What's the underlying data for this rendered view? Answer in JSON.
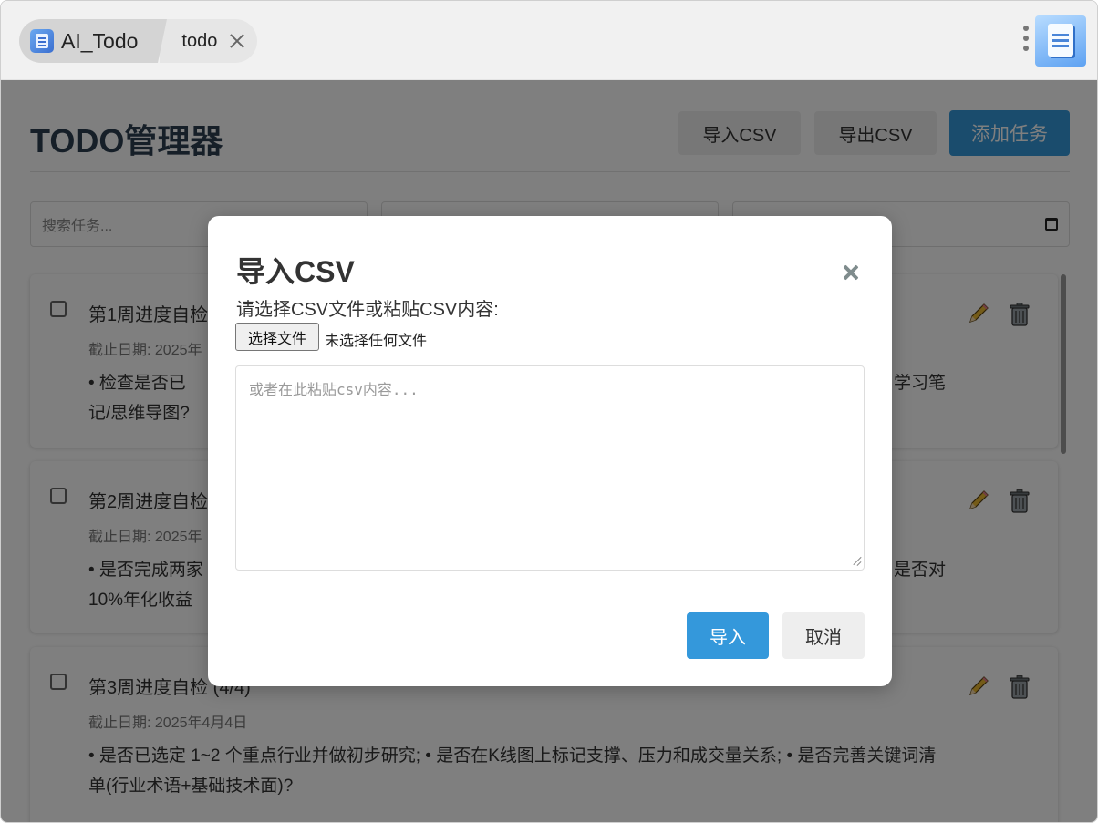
{
  "window": {
    "app_tab_label": "AI_Todo",
    "page_tab_label": "todo"
  },
  "header": {
    "title": "TODO管理器",
    "import_csv_label": "导入CSV",
    "export_csv_label": "导出CSV",
    "add_task_label": "添加任务"
  },
  "filters": {
    "search_placeholder": "搜索任务..."
  },
  "tasks": [
    {
      "title": "第1周进度自检",
      "due": "截止日期: 2025年",
      "desc": "• 检查是否已",
      "desc_tail": "学习笔",
      "desc_line2": "记/思维导图?"
    },
    {
      "title": "第2周进度自检",
      "due": "截止日期: 2025年",
      "desc": "• 是否完成两家",
      "desc_tail": "是否对",
      "desc_line2": "10%年化收益"
    },
    {
      "title": "第3周进度自检 (4/4)",
      "due": "截止日期: 2025年4月4日",
      "desc": "• 是否已选定 1~2 个重点行业并做初步研究; • 是否在K线图上标记支撑、压力和成交量关系; • 是否完善关键词清单(行业术语+基础技术面)?"
    }
  ],
  "modal": {
    "title": "导入CSV",
    "prompt": "请选择CSV文件或粘贴CSV内容:",
    "file_button_label": "选择文件",
    "file_status": "未选择任何文件",
    "textarea_placeholder": "或者在此粘贴csv内容...",
    "confirm_label": "导入",
    "cancel_label": "取消"
  },
  "icons": {
    "edit": "pencil-icon",
    "delete": "trash-icon",
    "close": "close-icon",
    "calendar": "calendar-icon",
    "menu": "kebab-menu-icon"
  },
  "colors": {
    "primary": "#3498db",
    "title_text": "#2c3e50",
    "overlay": "rgba(0,0,0,0.5)"
  }
}
